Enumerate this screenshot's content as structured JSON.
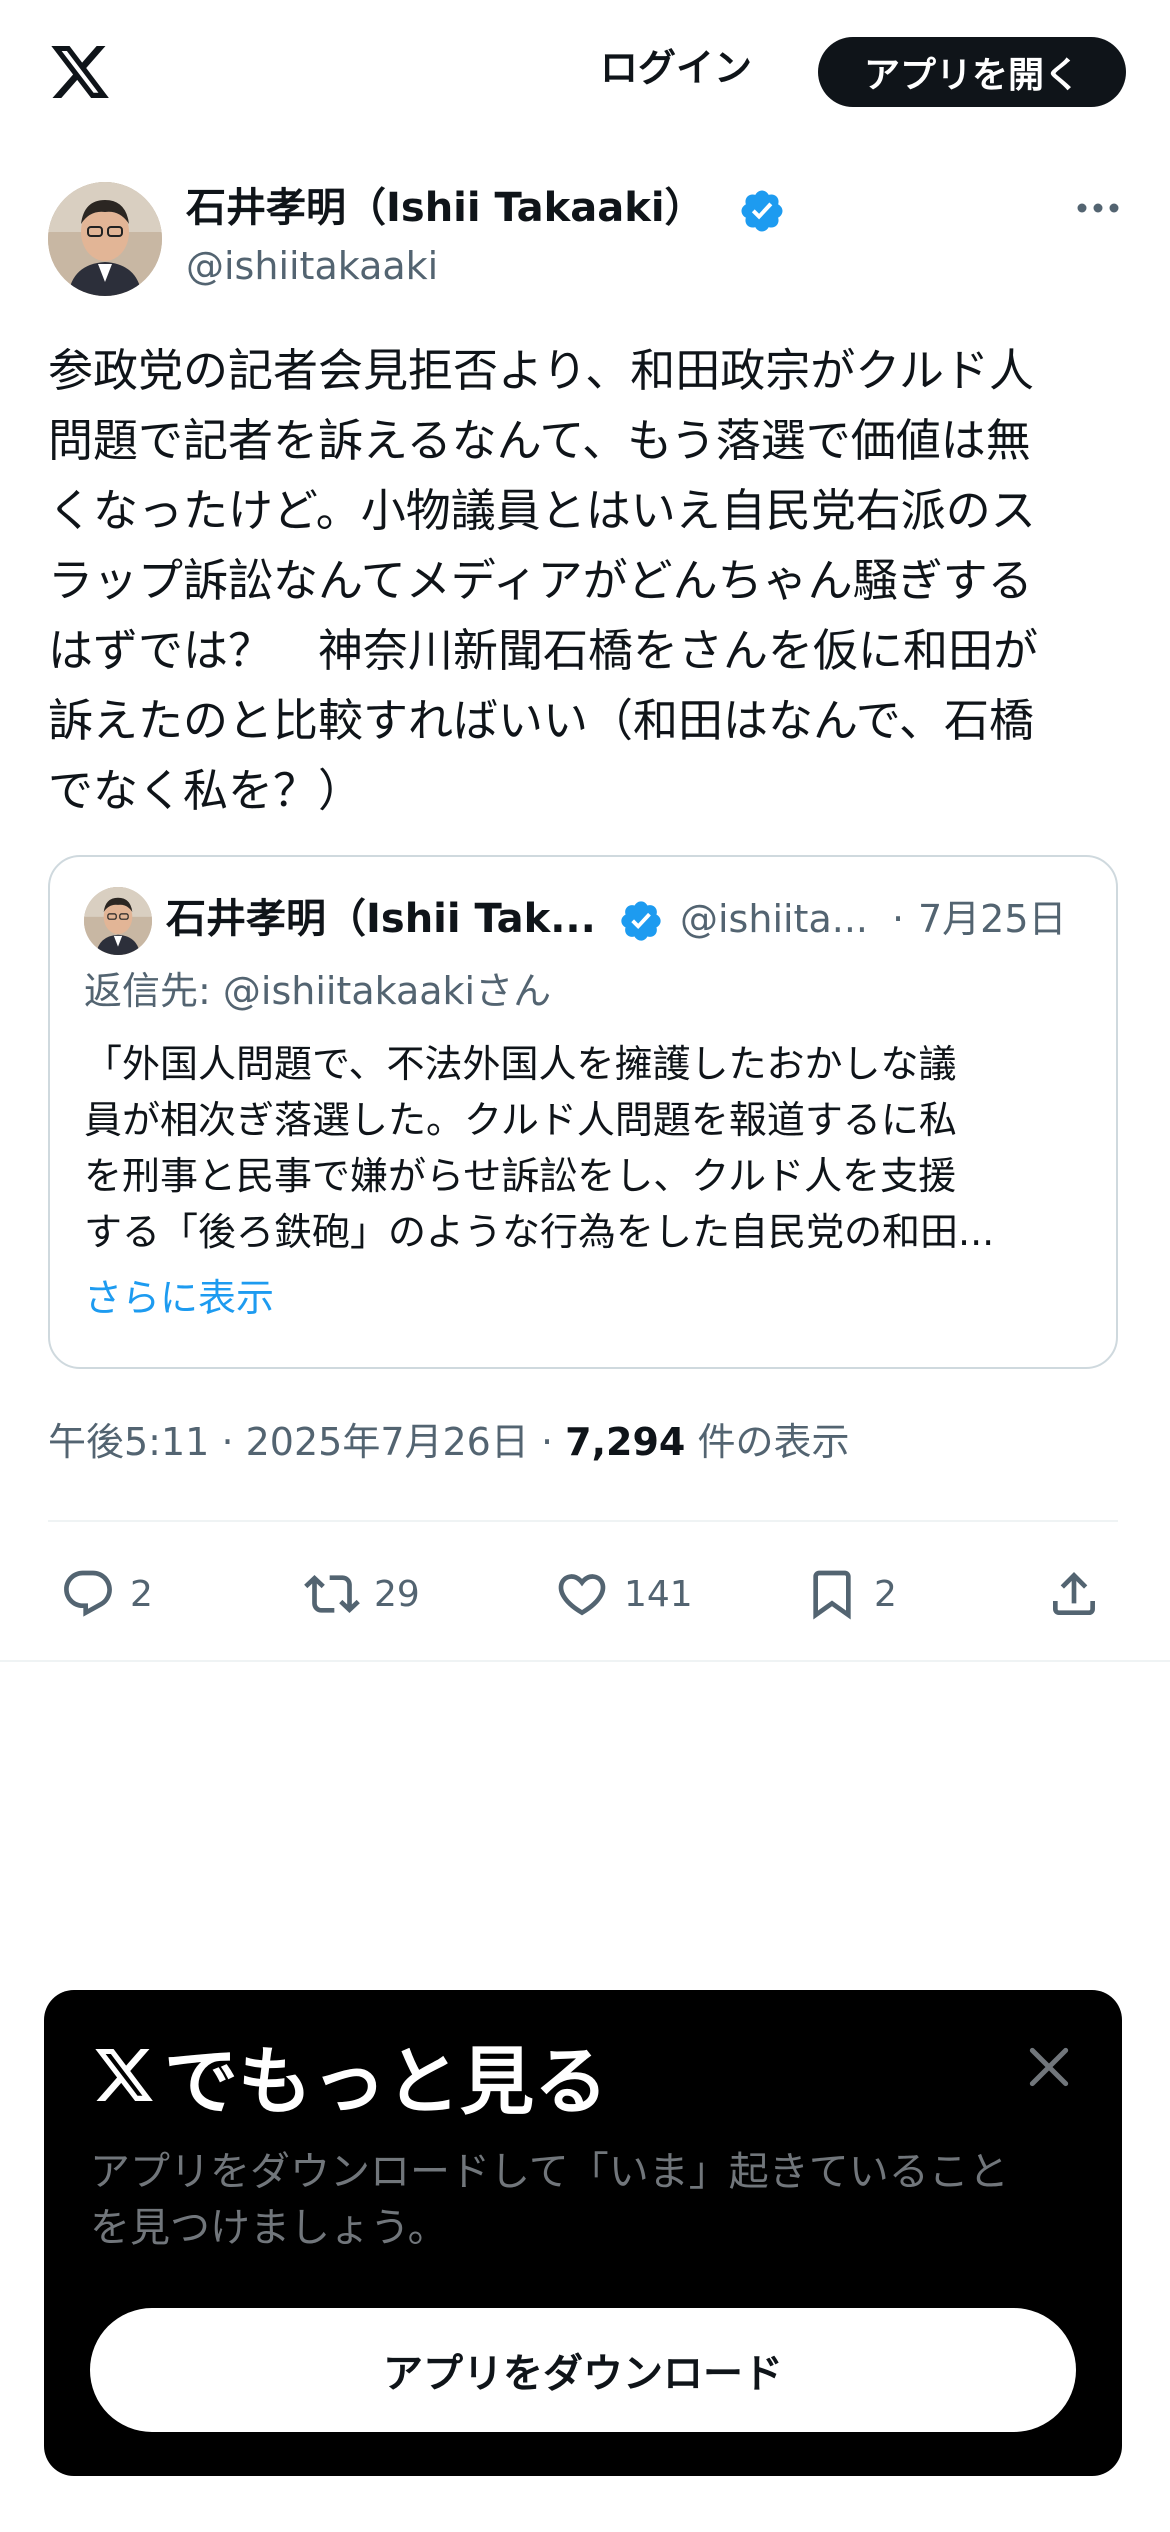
{
  "header": {
    "logo_icon": "x-logo-icon",
    "login_label": "ログイン",
    "open_app_label": "アプリを開く"
  },
  "tweet": {
    "author_name": "石井孝明（Ishii Takaaki）",
    "handle": "@ishiitakaaki",
    "verified_icon": "verified-badge-icon",
    "more_icon": "more-dots-icon",
    "text_lines": [
      "参政党の記者会見拒否より、和田政宗がクルド人",
      "問題で記者を訴えるなんて、もう落選で価値は無",
      "くなったけど。小物議員とはいえ自民党右派のス",
      "ラップ訴訟なんてメディアがどんちゃん騒ぎする",
      "はずでは？　神奈川新聞石橋をさんを仮に和田が",
      "訴えたのと比較すればいい（和田はなんで、石橋",
      "でなく私を？）"
    ],
    "time": "午後5:11",
    "separator": "·",
    "date": "2025年7月26日",
    "views_count": "7,294",
    "views_label": "件の表示"
  },
  "quote": {
    "author_name": "石井孝明（Ishii Tak...",
    "handle": "@ishiita...",
    "separator": "·",
    "date": "7月25日",
    "reply_to": "返信先: @ishiitakaakiさん",
    "text_lines": [
      "「外国人問題で、不法外国人を擁護したおかしな議",
      "員が相次ぎ落選した。クルド人問題を報道するに私",
      "を刑事と民事で嫌がらせ訴訟をし、クルド人を支援",
      "する「後ろ鉄砲」のような行為をした自民党の和田..."
    ],
    "show_more": "さらに表示"
  },
  "actions": {
    "reply_count": "2",
    "retweet_count": "29",
    "like_count": "141",
    "bookmark_count": "2",
    "icons": [
      "reply-icon",
      "retweet-icon",
      "like-icon",
      "bookmark-icon",
      "share-icon"
    ]
  },
  "sheet": {
    "title_text": "でもっと見る",
    "desc_lines": [
      "アプリをダウンロードして「いま」起きていること",
      "を見つけましょう。"
    ],
    "button_label": "アプリをダウンロード"
  },
  "colors": {
    "text": "#0f1419",
    "secondary": "#536471",
    "accent": "#1d9bf0",
    "sheet_bg": "#000000"
  }
}
